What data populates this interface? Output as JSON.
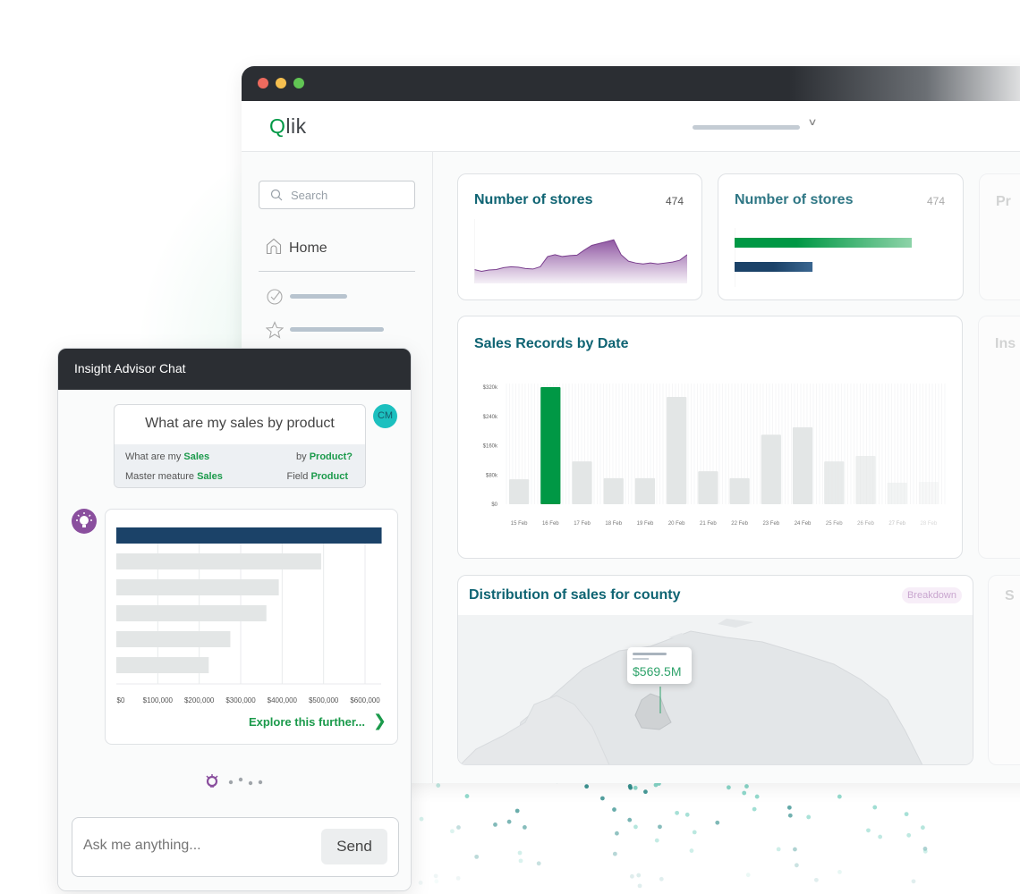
{
  "window": {
    "logo": "Qlik",
    "colors": {
      "brand_green": "#009845",
      "title_teal": "#0f6473",
      "dark": "#2b2e33",
      "purple": "#8a4f9e",
      "navy": "#1b4268"
    }
  },
  "sidebar": {
    "search_placeholder": "Search",
    "home_label": "Home",
    "items": [
      {
        "icon": "check-circle-icon"
      },
      {
        "icon": "star-icon"
      }
    ]
  },
  "cards": {
    "stores_area": {
      "title": "Number of stores",
      "value": "474",
      "sparkline": [
        30,
        26,
        29,
        30,
        34,
        36,
        35,
        32,
        31,
        36,
        58,
        62,
        58,
        60,
        61,
        72,
        82,
        86,
        90,
        94,
        62,
        48,
        44,
        42,
        44,
        42,
        44,
        46,
        50,
        62
      ]
    },
    "stores_bars": {
      "title": "Number of stores",
      "value": "474",
      "bar_fractions": [
        1.0,
        0.44
      ]
    },
    "faded_1": {
      "title": "Pr"
    },
    "faded_2": {
      "title": "Ins"
    },
    "faded_3": {
      "title": "S"
    }
  },
  "chart_data": [
    {
      "type": "bar",
      "title": "Sales Records by Date",
      "categories": [
        "15 Feb",
        "16 Feb",
        "17 Feb",
        "18 Feb",
        "19 Feb",
        "20 Feb",
        "21 Feb",
        "22 Feb",
        "23 Feb",
        "24 Feb",
        "25 Feb",
        "26 Feb",
        "27 Feb",
        "28 Feb"
      ],
      "values": [
        68000,
        320000,
        117000,
        71000,
        71000,
        293000,
        90000,
        71000,
        190000,
        210000,
        117000,
        132000,
        59000,
        61000
      ],
      "highlighted": "16 Feb",
      "yticks": [
        "$0",
        "$80k",
        "$160k",
        "$240k",
        "$320k"
      ],
      "ylim": [
        0,
        320000
      ],
      "grid": true
    },
    {
      "type": "bar",
      "orientation": "horizontal",
      "values": [
        640000,
        494000,
        392000,
        362000,
        275000,
        223000
      ],
      "xticks": [
        "$0",
        "$100,000",
        "$200,000",
        "$300,000",
        "$400,000",
        "$500,000",
        "$600,000"
      ],
      "xlim": [
        0,
        600000
      ],
      "grid": true
    }
  ],
  "map": {
    "title": "Distribution of sales for county",
    "breakdown_label": "Breakdown",
    "tooltip_value": "$569.5M"
  },
  "chat": {
    "title": "Insight Advisor Chat",
    "avatar_initials": "CM",
    "question": "What are my sales by product",
    "parse": {
      "q1_prefix": "What are my ",
      "q1_term": "Sales",
      "q2_prefix": "by ",
      "q2_term": "Product?",
      "m_prefix": "Master meature ",
      "m_term": "Sales",
      "f_prefix": "Field ",
      "f_term": "Product"
    },
    "explore_label": "Explore this further...",
    "input_placeholder": "Ask me anything...",
    "send_label": "Send"
  }
}
